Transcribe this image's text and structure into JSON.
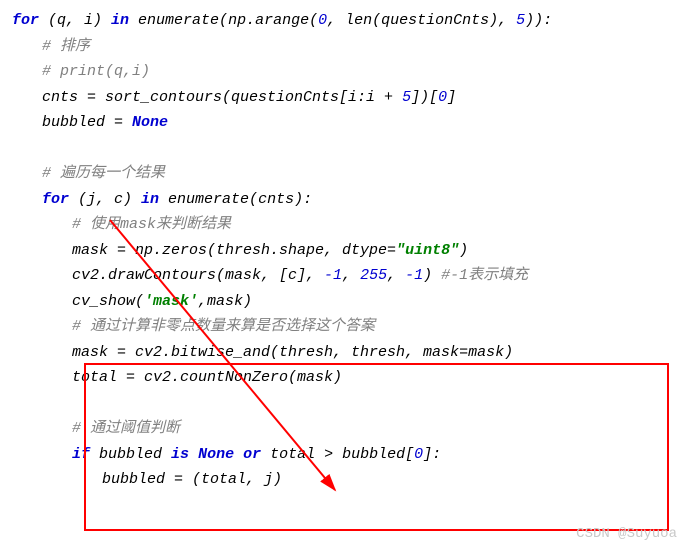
{
  "code": {
    "l1a": "for",
    "l1b": " (q, i) ",
    "l1c": "in",
    "l1d": " enumerate(np.arange(",
    "l1e": "0",
    "l1f": ", len(questionCnts), ",
    "l1g": "5",
    "l1h": ")):",
    "l2": "# 排序",
    "l3": "# print(q,i)",
    "l4a": "cnts = sort_contours(questionCnts[i:i + ",
    "l4b": "5",
    "l4c": "])[",
    "l4d": "0",
    "l4e": "]",
    "l5a": "bubbled = ",
    "l5b": "None",
    "l6": "# 遍历每一个结果",
    "l7a": "for",
    "l7b": " (j, c) ",
    "l7c": "in",
    "l7d": " enumerate(cnts):",
    "l8": "# 使用mask来判断结果",
    "l9a": "mask = np.zeros(thresh.shape, dtype=",
    "l9b": "\"uint8\"",
    "l9c": ")",
    "l10a": "cv2.drawContours(mask, [c], ",
    "l10b": "-1",
    "l10c": ", ",
    "l10d": "255",
    "l10e": ", ",
    "l10f": "-1",
    "l10g": ") ",
    "l10h": "#-1表示填充",
    "l11a": "cv_show(",
    "l11b": "'mask'",
    "l11c": ",mask)",
    "l12": "# 通过计算非零点数量来算是否选择这个答案",
    "l13": "mask = cv2.bitwise_and(thresh, thresh, mask=mask)",
    "l14": "total = cv2.countNonZero(mask)",
    "l15": "# 通过阈值判断",
    "l16a": "if",
    "l16b": " bubbled ",
    "l16c": "is",
    "l16d": " ",
    "l16e": "None",
    "l16f": " ",
    "l16g": "or",
    "l16h": " total > bubbled[",
    "l16i": "0",
    "l16j": "]:",
    "l17": "bubbled = (total, j)"
  },
  "watermark": "CSDN @Suyuoa"
}
